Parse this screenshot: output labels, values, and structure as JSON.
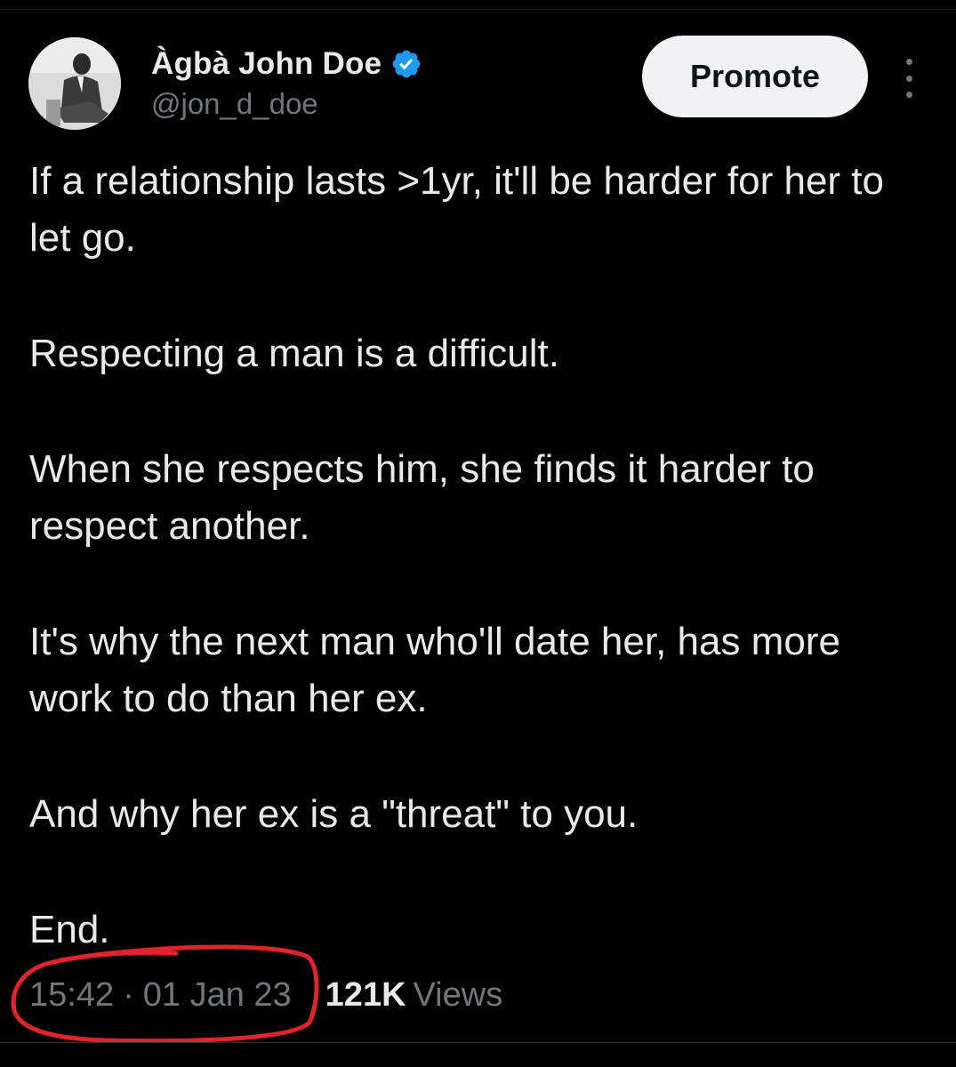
{
  "author": {
    "display_name": "Àgbà John Doe",
    "handle": "@jon_d_doe",
    "verified": true,
    "verified_color": "#1d9bf0"
  },
  "header": {
    "promote_label": "Promote",
    "more_icon": "more-vertical-icon"
  },
  "tweet": {
    "paragraphs": [
      "If a relationship lasts >1yr, it'll be harder for her to let go.",
      "Respecting a man is a difficult.",
      "When she respects him, she finds it harder to respect another.",
      "It's why the next man who'll date her, has more work to do than her ex.",
      "And why her ex is a \"threat\" to you.",
      "End."
    ]
  },
  "meta": {
    "time": "15:42",
    "separator": "·",
    "date": "01 Jan 23",
    "views_count": "121K",
    "views_label": "Views"
  },
  "colors": {
    "background": "#000000",
    "text_primary": "#e7e9ea",
    "text_secondary": "#71767b",
    "annotation_red": "#e0242b",
    "button_bg": "#eff3f4"
  }
}
